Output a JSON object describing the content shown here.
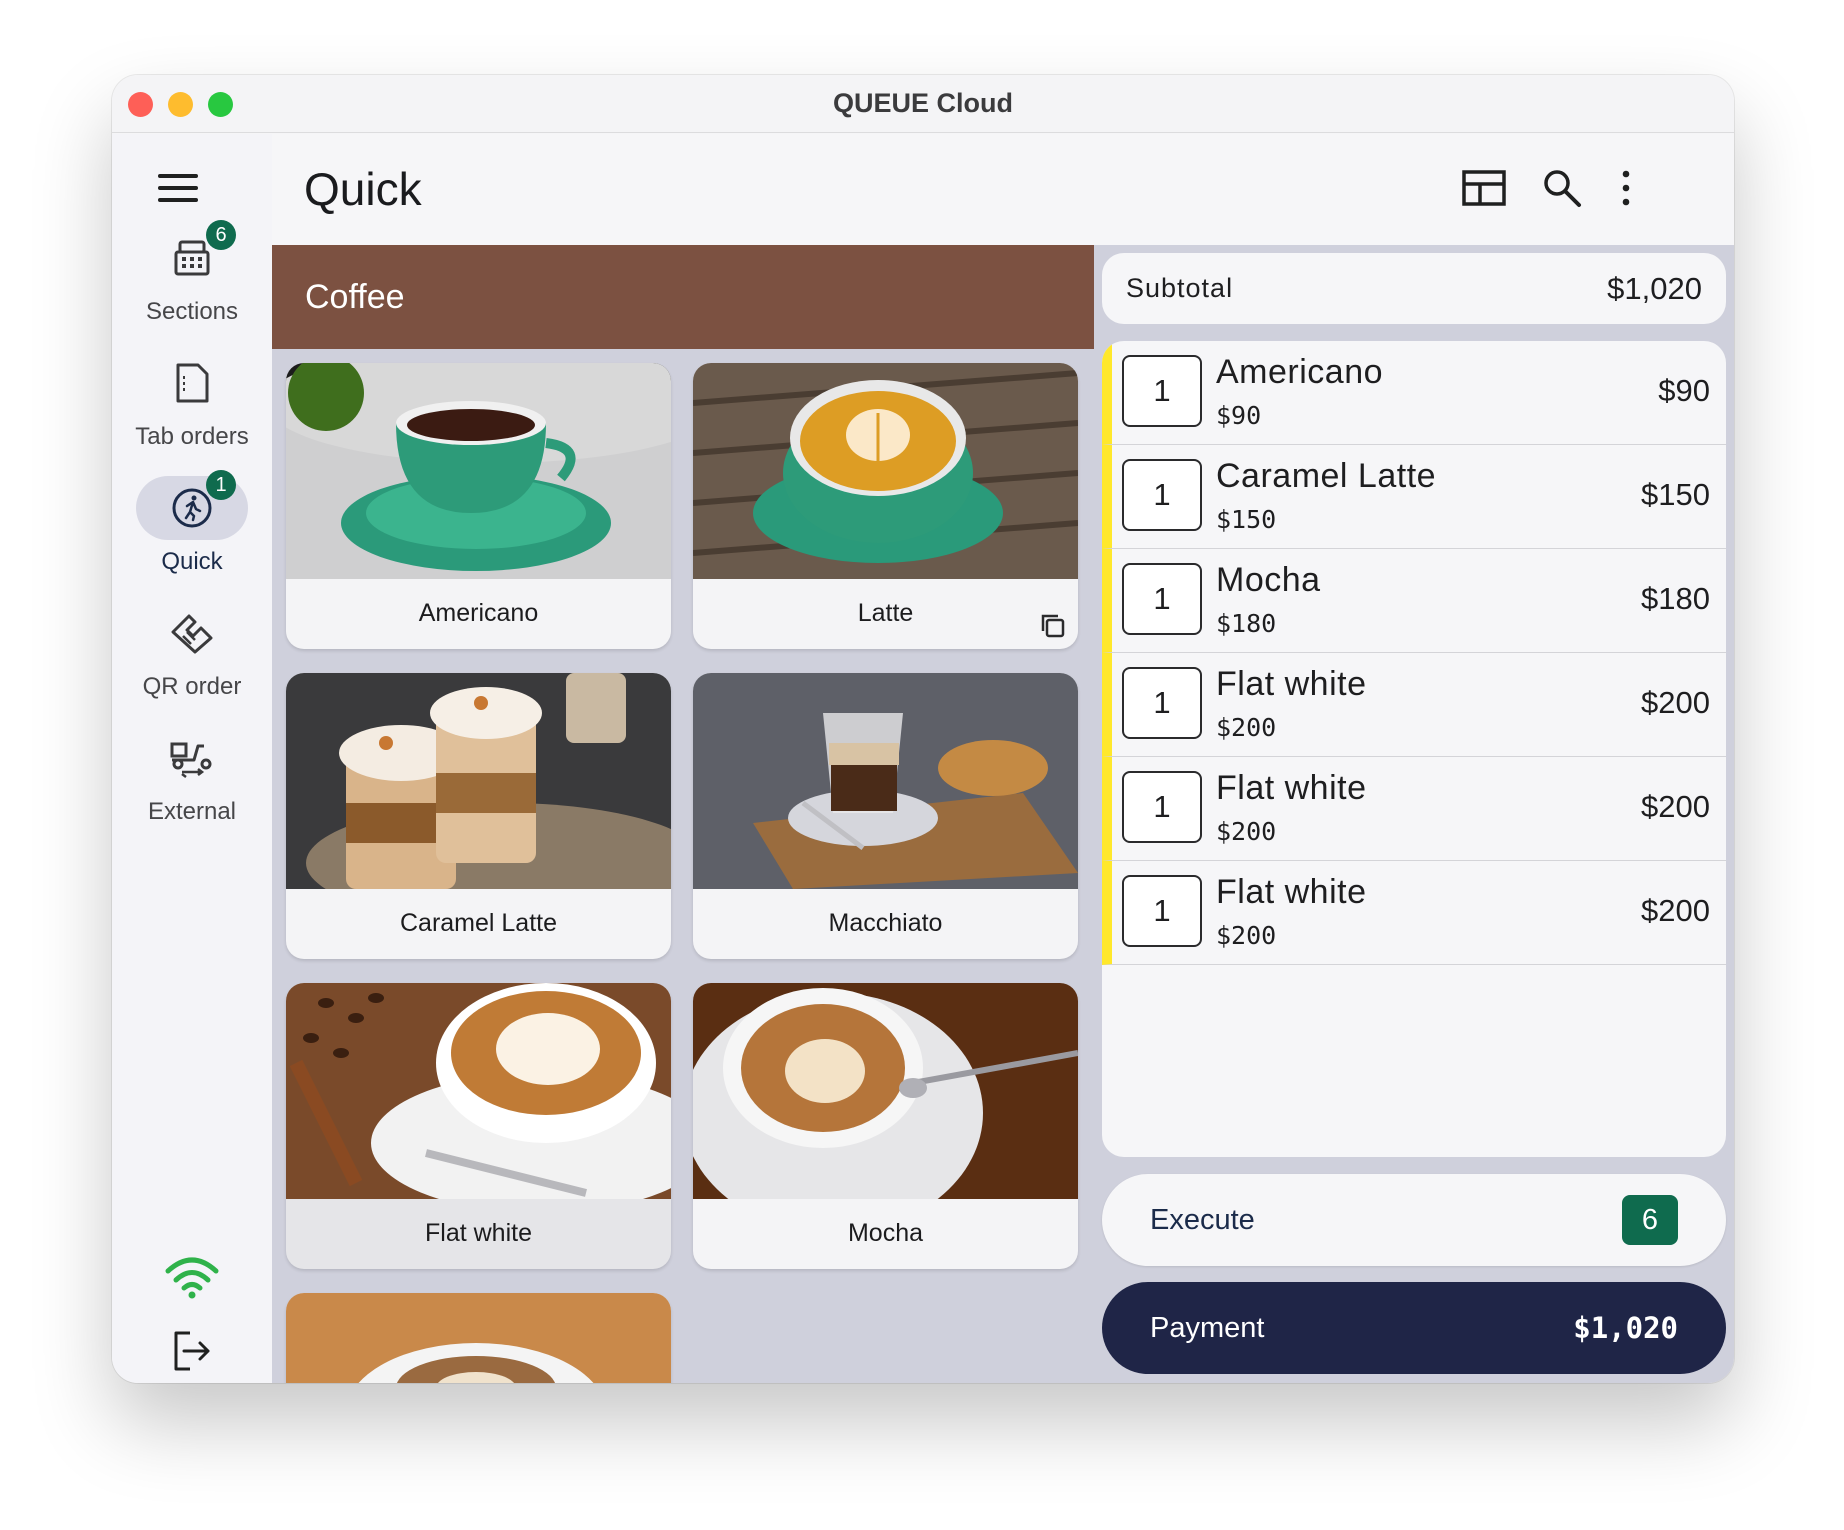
{
  "window": {
    "title": "QUEUE Cloud"
  },
  "sidebar": {
    "items": [
      {
        "label": "Sections",
        "icon": "cash-register-icon",
        "badge": "6"
      },
      {
        "label": "Tab orders",
        "icon": "document-icon"
      },
      {
        "label": "Quick",
        "icon": "quick-run-icon",
        "badge": "1",
        "active": true
      },
      {
        "label": "QR order",
        "icon": "handshake-icon"
      },
      {
        "label": "External",
        "icon": "delivery-scooter-icon"
      }
    ]
  },
  "header": {
    "title": "Quick"
  },
  "category": {
    "name": "Coffee",
    "color": "#7c5141"
  },
  "products": [
    {
      "name": "Americano"
    },
    {
      "name": "Latte"
    },
    {
      "name": "Caramel Latte"
    },
    {
      "name": "Macchiato"
    },
    {
      "name": "Flat white"
    },
    {
      "name": "Mocha"
    }
  ],
  "order": {
    "subtotal_label": "Subtotal",
    "subtotal_value": "$1,020",
    "items": [
      {
        "qty": "1",
        "name": "Americano",
        "unit_price": "$90",
        "total": "$90"
      },
      {
        "qty": "1",
        "name": "Caramel Latte",
        "unit_price": "$150",
        "total": "$150"
      },
      {
        "qty": "1",
        "name": "Mocha",
        "unit_price": "$180",
        "total": "$180"
      },
      {
        "qty": "1",
        "name": "Flat white",
        "unit_price": "$200",
        "total": "$200"
      },
      {
        "qty": "1",
        "name": "Flat white",
        "unit_price": "$200",
        "total": "$200"
      },
      {
        "qty": "1",
        "name": "Flat white",
        "unit_price": "$200",
        "total": "$200"
      }
    ],
    "execute_label": "Execute",
    "execute_count": "6",
    "payment_label": "Payment",
    "payment_value": "$1,020"
  },
  "colors": {
    "accent_green": "#0f6b4e",
    "payment_navy": "#1f2547",
    "item_marker_yellow": "#ffe82b",
    "wifi_green": "#2fb24a"
  }
}
